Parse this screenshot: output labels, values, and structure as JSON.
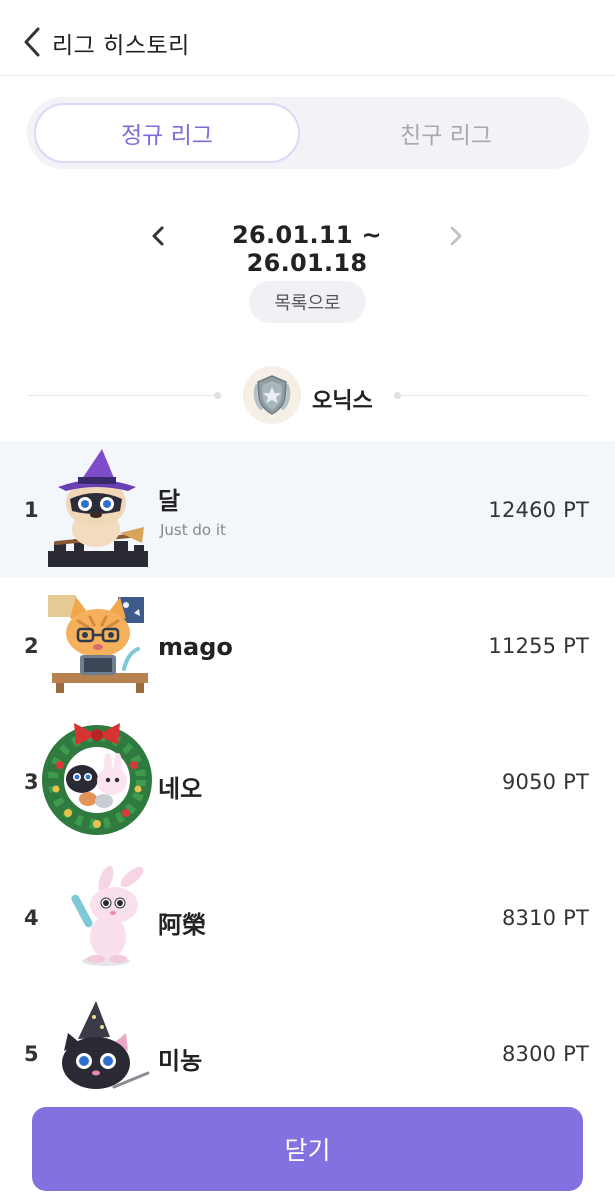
{
  "header": {
    "title": "리그 히스토리",
    "back_icon": "chevron-left-icon"
  },
  "tabs": [
    {
      "label": "정규 리그",
      "active": true
    },
    {
      "label": "친구 리그",
      "active": false
    }
  ],
  "week": {
    "range": "26.01.11 ~ 26.01.18",
    "prev_icon": "chevron-left-icon",
    "next_icon": "chevron-right-icon"
  },
  "list_button": "목록으로",
  "tier": {
    "name": "오닉스",
    "badge_icon": "onyx-shield-badge-icon"
  },
  "rankings": [
    {
      "rank": "1",
      "name": "달",
      "motto": "Just do it",
      "points": "12460 PT",
      "avatar": "witch-raccoon-avatar",
      "highlighted": true
    },
    {
      "rank": "2",
      "name": "mago",
      "motto": "",
      "points": "11255 PT",
      "avatar": "cat-desk-avatar",
      "highlighted": false
    },
    {
      "rank": "3",
      "name": "네오",
      "motto": "",
      "points": "9050 PT",
      "avatar": "christmas-wreath-avatar",
      "highlighted": false
    },
    {
      "rank": "4",
      "name": "阿榮",
      "motto": "",
      "points": "8310 PT",
      "avatar": "pink-rabbit-avatar",
      "highlighted": false
    },
    {
      "rank": "5",
      "name": "미농",
      "motto": "",
      "points": "8300 PT",
      "avatar": "wizard-cat-avatar",
      "highlighted": false
    }
  ],
  "close_button": "닫기",
  "colors": {
    "accent": "#8272e0",
    "active_tab_text": "#7c6dd8",
    "highlight_row": "#f3f6fb"
  }
}
